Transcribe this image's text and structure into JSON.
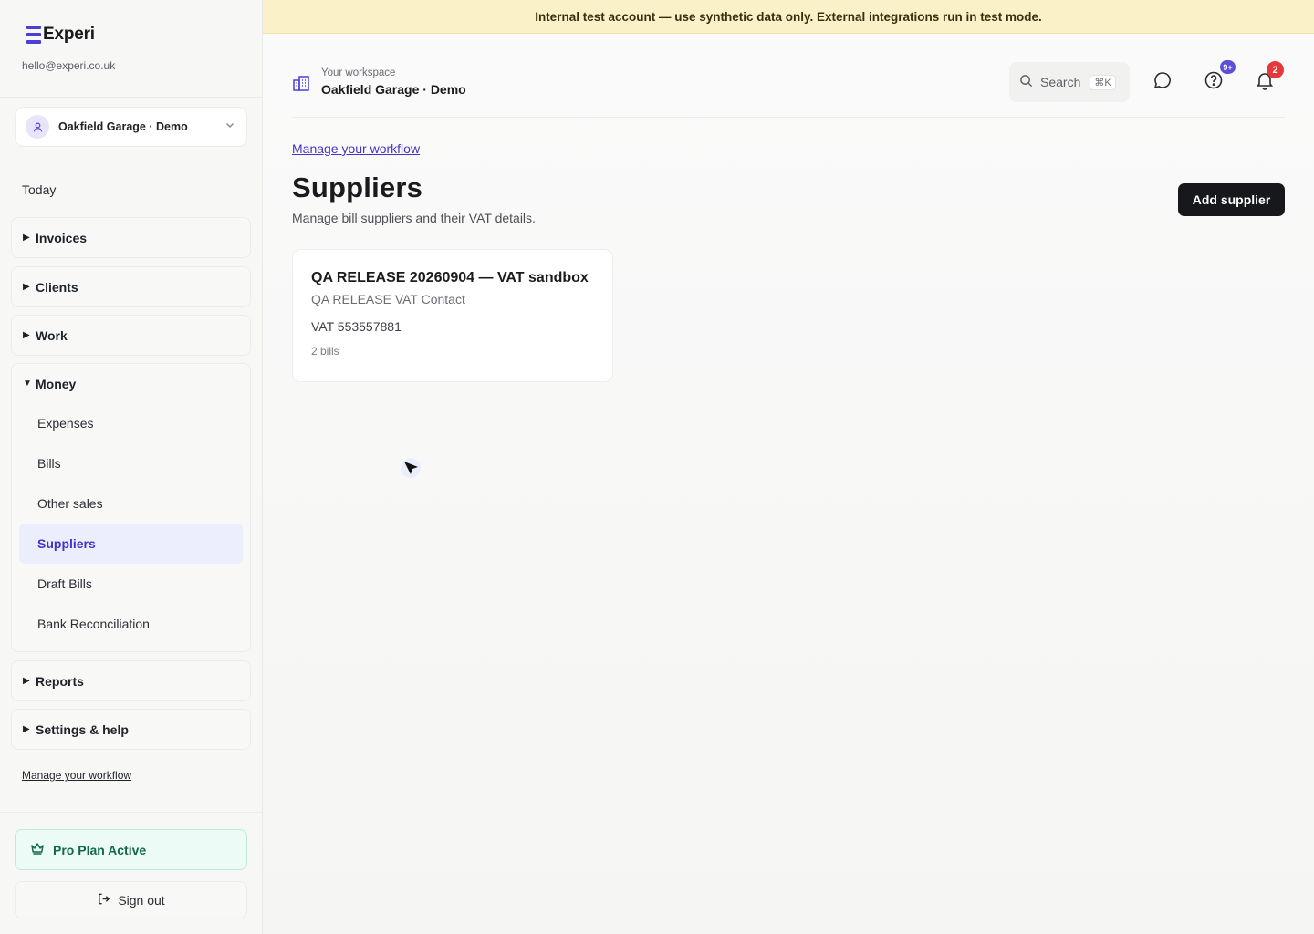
{
  "banner": {
    "text": "Internal test account — use synthetic data only. External integrations run in test mode."
  },
  "sidebar": {
    "brand": "Experi",
    "email": "hello@experi.co.uk",
    "workspace_select": "Oakfield Garage · Demo",
    "today": "Today",
    "groups": [
      {
        "label": "Invoices",
        "expanded": false
      },
      {
        "label": "Clients",
        "expanded": false
      },
      {
        "label": "Work",
        "expanded": false
      },
      {
        "label": "Money",
        "expanded": true,
        "items": [
          "Expenses",
          "Bills",
          "Other sales",
          "Suppliers",
          "Draft Bills",
          "Bank Reconciliation"
        ],
        "active": "Suppliers"
      },
      {
        "label": "Reports",
        "expanded": false
      },
      {
        "label": "Settings & help",
        "expanded": false
      }
    ],
    "workflow_link": "Manage your workflow",
    "plan": "Pro Plan Active",
    "sign_out": "Sign out"
  },
  "topbar": {
    "workspace_caption": "Your workspace",
    "workspace_name": "Oakfield Garage · Demo",
    "search_label": "Search",
    "search_shortcut": "⌘K",
    "help_badge": "9+",
    "notifications_badge": "2"
  },
  "page": {
    "breadcrumb": "Manage your workflow",
    "title": "Suppliers",
    "subtitle": "Manage bill suppliers and their VAT details.",
    "add_button": "Add supplier"
  },
  "suppliers": [
    {
      "name": "QA RELEASE 20260904 — VAT sandbox",
      "contact": "QA RELEASE VAT Contact",
      "vat": "VAT 553557881",
      "bills": "2 bills"
    }
  ],
  "colors": {
    "accent": "#4433c4",
    "brand": "#4b3fd6",
    "banner": "#fbf1c9",
    "plan_green": "#11684b",
    "badge_red": "#e5383b"
  }
}
